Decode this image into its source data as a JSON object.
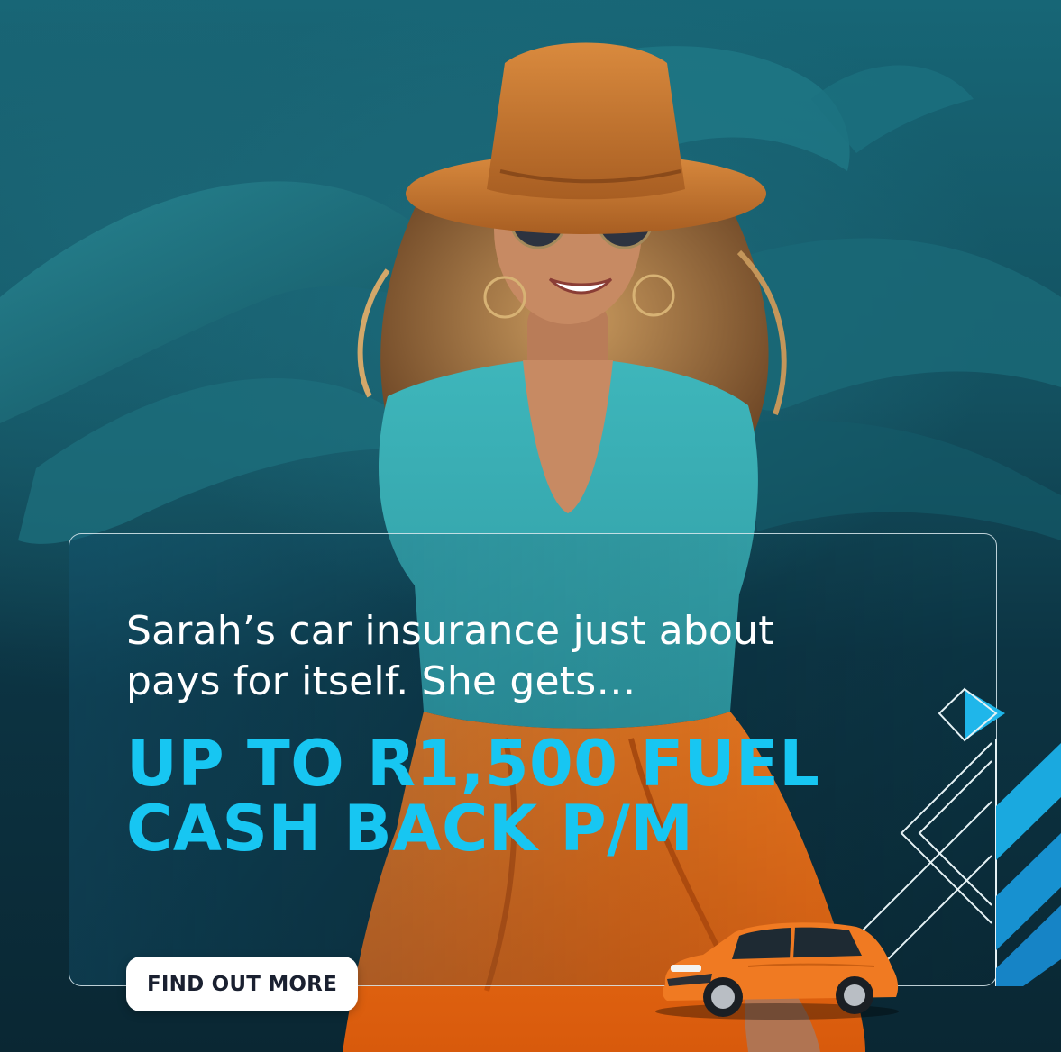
{
  "ad": {
    "lead_text": "Sarah’s car insurance just about pays for itself. She gets…",
    "headline": "UP TO R1,500 FUEL CASH BACK P/M",
    "cta_label": "FIND OUT MORE"
  },
  "colors": {
    "accent_cyan": "#17c6f2",
    "background_teal": "#13505f",
    "car_orange": "#f07a22",
    "skirt_orange": "#f36b12"
  },
  "icons": {
    "decoration": "chevron-stripes-graphic",
    "vehicle": "orange-hatchback-car"
  }
}
